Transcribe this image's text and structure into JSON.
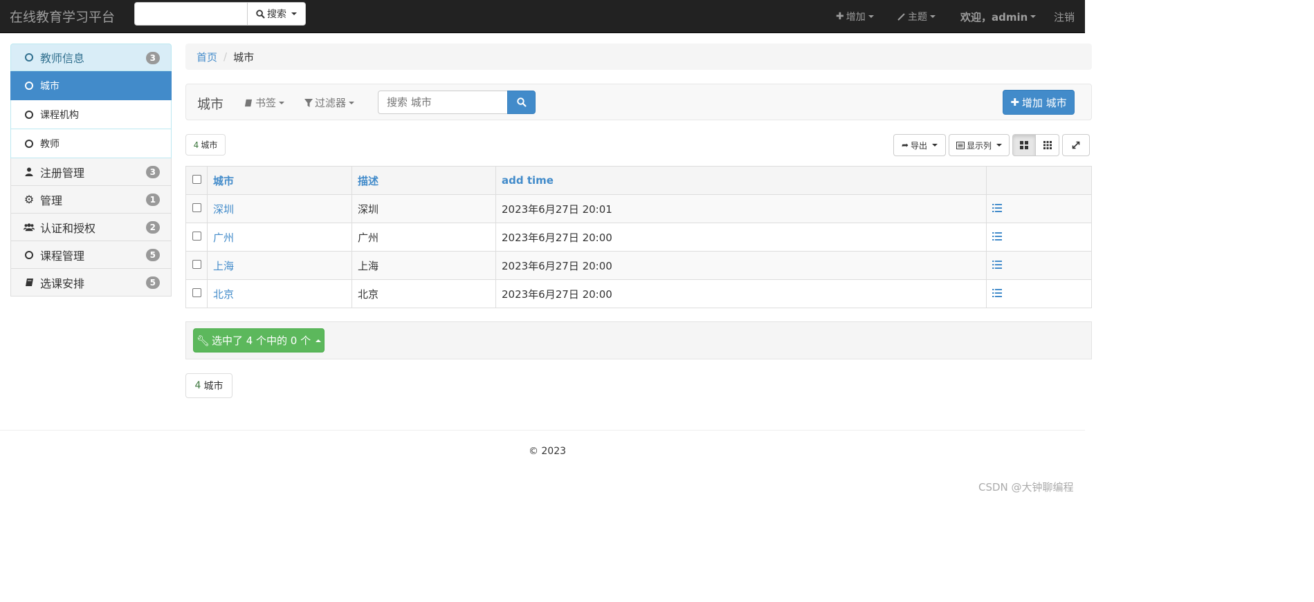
{
  "navbar": {
    "brand": "在线教育学习平台",
    "search_button": "搜索",
    "add_label": "增加",
    "theme_label": "主题",
    "user_label": "欢迎，admin",
    "logout_label": "注销"
  },
  "sidebar": {
    "items": [
      {
        "label": "教师信息",
        "badge": "3",
        "icon": "circle-o-icon"
      },
      {
        "label": "城市",
        "icon": "circle-o-icon"
      },
      {
        "label": "课程机构",
        "icon": "circle-o-icon"
      },
      {
        "label": "教师",
        "icon": "circle-o-icon"
      },
      {
        "label": "注册管理",
        "badge": "3",
        "icon": "user-icon"
      },
      {
        "label": "管理",
        "badge": "1",
        "icon": "gear-icon"
      },
      {
        "label": "认证和授权",
        "badge": "2",
        "icon": "group-icon"
      },
      {
        "label": "课程管理",
        "badge": "5",
        "icon": "circle-o-icon"
      },
      {
        "label": "选课安排",
        "badge": "5",
        "icon": "book-icon"
      }
    ]
  },
  "breadcrumb": {
    "home": "首页",
    "current": "城市"
  },
  "titlebar": {
    "title": "城市",
    "bookmark": "书签",
    "filter": "过滤器",
    "search_placeholder": "搜索 城市",
    "add_button": "增加 城市"
  },
  "toolbar": {
    "count_num": "4",
    "count_label": "城市",
    "export": "导出",
    "columns": "显示列"
  },
  "table": {
    "headers": [
      "城市",
      "描述",
      "add time"
    ],
    "rows": [
      {
        "city": "深圳",
        "desc": "深圳",
        "time": "2023年6月27日 20:01"
      },
      {
        "city": "广州",
        "desc": "广州",
        "time": "2023年6月27日 20:00"
      },
      {
        "city": "上海",
        "desc": "上海",
        "time": "2023年6月27日 20:00"
      },
      {
        "city": "北京",
        "desc": "北京",
        "time": "2023年6月27日 20:00"
      }
    ]
  },
  "actions": {
    "selected_label": "选中了 4 个中的 0 个"
  },
  "bottom_count": {
    "num": "4",
    "label": "城市"
  },
  "footer": {
    "copyright": "© 2023"
  },
  "watermark": "CSDN @大钟聊编程",
  "colors": {
    "primary": "#428bca",
    "success": "#5cb85c",
    "navbar": "#222222"
  }
}
